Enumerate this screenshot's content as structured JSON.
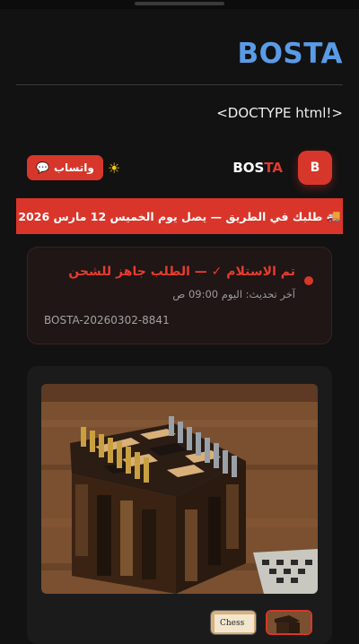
{
  "page": {
    "brand_title": "BOSTA",
    "doctype_text": "<DOCTYPE html!>"
  },
  "header": {
    "logo_letter": "B",
    "logo_text_main": "BOS",
    "logo_text_accent": "TA",
    "theme_icon": "sun-icon",
    "whatsapp_label": "واتساب",
    "whatsapp_icon": "💬",
    "accent_color": "#d7372b"
  },
  "banner": {
    "icon": "🚚",
    "text": "طلبك في الطريق — يصل يوم الخميس 12 مارس 2026"
  },
  "status": {
    "title": "تم الاستلام ✓ — الطلب جاهز للشحن",
    "last_update": "آخر تحديث: اليوم 09:00 ص",
    "tracking_number": "BOSTA-20260302-8841"
  },
  "gallery": {
    "main_image": "chess-table-photo",
    "thumbnails": [
      {
        "name": "chess-set-box-thumb",
        "label": "Chess",
        "selected": false
      },
      {
        "name": "chess-table-thumb",
        "selected": true
      }
    ]
  }
}
